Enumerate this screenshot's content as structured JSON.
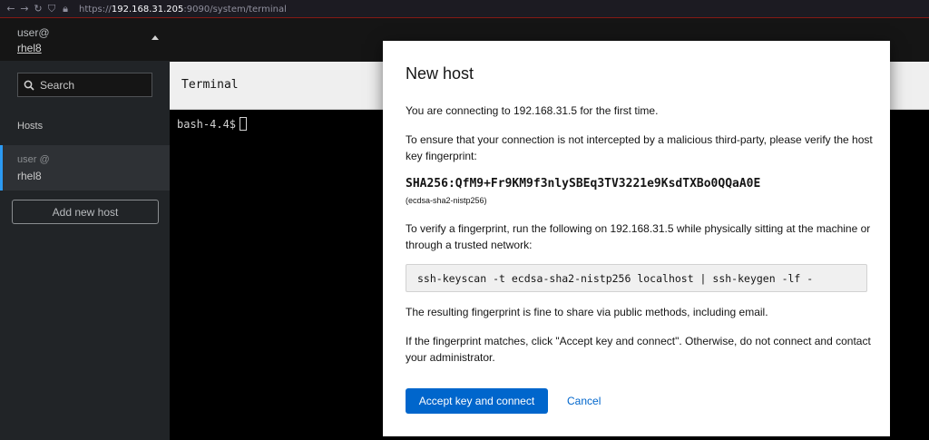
{
  "browser": {
    "url_prefix": "https://",
    "url_host": "192.168.31.205",
    "url_rest": ":9090/system/terminal"
  },
  "sidebar": {
    "switcher_user": "user@",
    "switcher_host": "rhel8",
    "search_placeholder": "Search",
    "hosts_label": "Hosts",
    "host_item": {
      "user": "user @",
      "host": "rhel8"
    },
    "add_host_label": "Add new host"
  },
  "main": {
    "terminal_title": "Terminal",
    "prompt": "bash-4.4$"
  },
  "modal": {
    "title": "New host",
    "intro": "You are connecting to 192.168.31.5 for the first time.",
    "ensure": "To ensure that your connection is not intercepted by a malicious third-party, please verify the host key fingerprint:",
    "fingerprint": "SHA256:QfM9+Fr9KM9f3nlySBEq3TV3221e9KsdTXBo0QQaA0E",
    "fingerprint_type": "(ecdsa-sha2-nistp256)",
    "verify": "To verify a fingerprint, run the following on 192.168.31.5 while physically sitting at the machine or through a trusted network:",
    "command": "ssh-keyscan -t ecdsa-sha2-nistp256 localhost | ssh-keygen -lf -",
    "share": "The resulting fingerprint is fine to share via public methods, including email.",
    "matches": "If the fingerprint matches, click \"Accept key and connect\". Otherwise, do not connect and contact your administrator.",
    "accept_label": "Accept key and connect",
    "cancel_label": "Cancel"
  },
  "colors": {
    "primary": "#0066cc",
    "sidebar": "#212427",
    "active_indicator": "#2b9af3"
  }
}
